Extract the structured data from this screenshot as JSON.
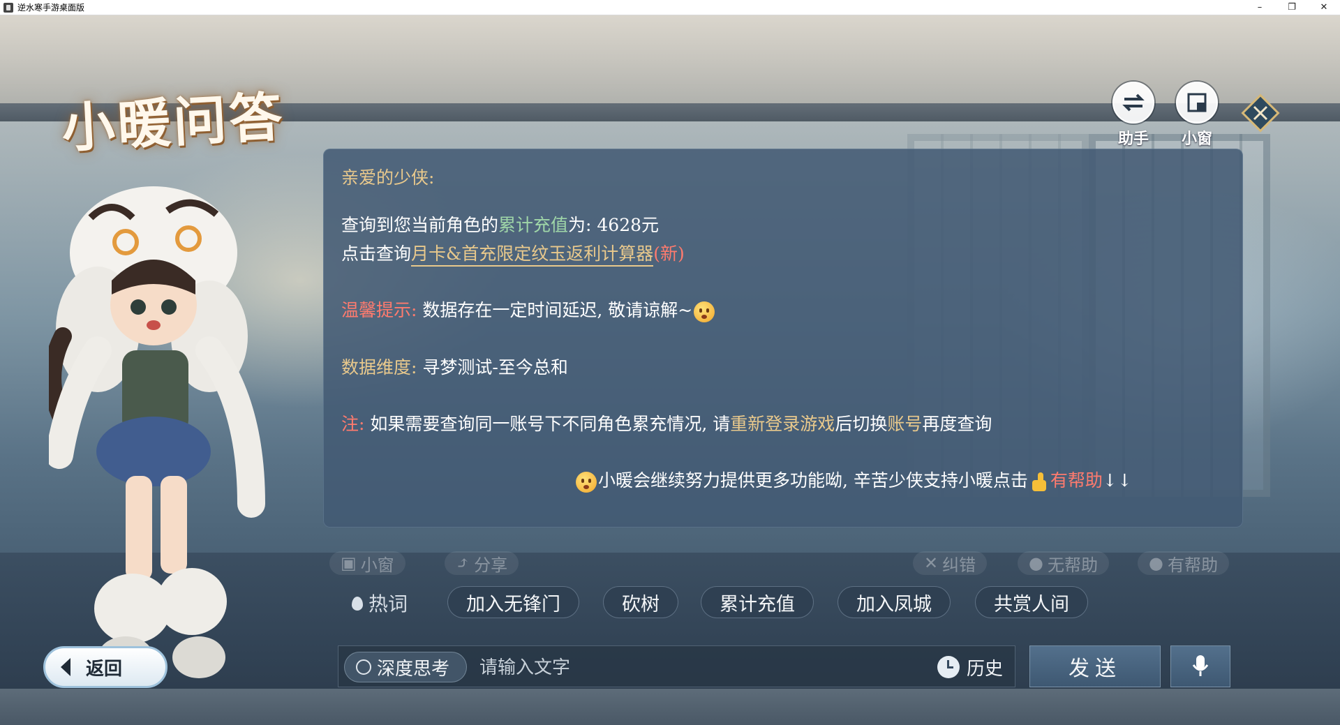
{
  "window": {
    "title": "逆水寒手游桌面版",
    "minimize": "–",
    "restore": "❐",
    "close": "✕"
  },
  "page_title": "小暖问答",
  "top_buttons": {
    "assistant": "助手",
    "mini_window": "小窗"
  },
  "answer": {
    "greeting": "亲爱的少侠:",
    "query_prefix": "查询到您当前角色的",
    "query_highlight": "累计充值",
    "query_suffix": "为: 4628元",
    "click_prefix": "点击查询",
    "calc_link": "月卡&首充限定纹玉返利计算器",
    "calc_new": "(新)",
    "tip_label": "温馨提示:",
    "tip_text": "数据存在一定时间延迟, 敬请谅解~",
    "dimension_label": "数据维度:",
    "dimension_text": "寻梦测试-至今总和",
    "note_label": "注:",
    "note_text1": "如果需要查询同一账号下不同角色累充情况, 请",
    "note_relogin": "重新登录游戏",
    "note_text2": "后切换",
    "note_account": "账号",
    "note_text3": "再度查询",
    "footer_text": "小暖会继续努力提供更多功能呦, 辛苦少侠支持小暖点击",
    "footer_helpful": "有帮助",
    "footer_arrows": "↓↓"
  },
  "ghost_actions": {
    "mini_window": "小窗",
    "share": "分享",
    "correct": "纠错",
    "not_helpful": "无帮助",
    "helpful": "有帮助"
  },
  "hot_words": {
    "label": "热词",
    "items": [
      "加入无锋门",
      "砍树",
      "累计充值",
      "加入凤城",
      "共赏人间"
    ]
  },
  "bottom": {
    "back": "返回",
    "deep_think": "深度思考",
    "input_placeholder": "请输入文字",
    "history": "历史",
    "send": "发送"
  },
  "colors": {
    "gold": "#e9c98c",
    "green": "#9fd6a8",
    "red": "#ff7b6e",
    "panel": "#425a73"
  }
}
